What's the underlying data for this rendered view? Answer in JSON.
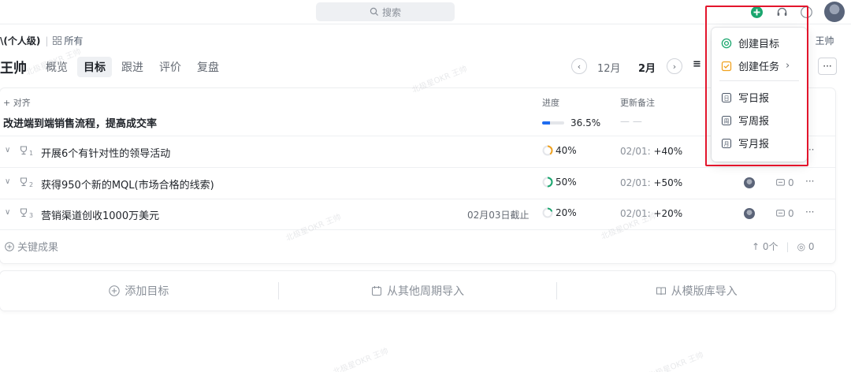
{
  "topbar": {
    "search_placeholder": "搜索"
  },
  "header": {
    "breadcrumb_scope": "\\(个人级)",
    "breadcrumb_all": "所有",
    "breadcrumb_right": "王帅",
    "owner": "王帅",
    "tabs": [
      "概览",
      "目标",
      "跟进",
      "评价",
      "复盘"
    ],
    "active_tab": "目标",
    "months": {
      "prev": "12月",
      "current": "2月"
    },
    "more": "···"
  },
  "table": {
    "align_label": "+ 对齐",
    "col_progress": "进度",
    "col_note": "更新备注",
    "objective": {
      "title": "改进端到端销售流程，提高成交率",
      "progress": 36.5,
      "progress_label": "36.5%",
      "note": "— —"
    },
    "key_results": [
      {
        "index": "1",
        "title": "开展6个有针对性的领导活动",
        "deadline": "",
        "progress": 0.4,
        "progress_label": "40%",
        "note_date": "02/01:",
        "note_value": "+40%",
        "comments": "",
        "more": "···"
      },
      {
        "index": "2",
        "title": "获得950个新的MQL(市场合格的线索)",
        "deadline": "",
        "progress": 0.5,
        "progress_label": "50%",
        "note_date": "02/01:",
        "note_value": "+50%",
        "comments": "0",
        "more": "···"
      },
      {
        "index": "3",
        "title": "营销渠道创收1000万美元",
        "deadline": "02月03日截止",
        "progress": 0.2,
        "progress_label": "20%",
        "note_date": "02/01:",
        "note_value": "+20%",
        "comments": "0",
        "more": "···"
      }
    ],
    "add_kr": "关键成果",
    "stats": {
      "up": "0个",
      "views": "0"
    }
  },
  "actions": {
    "add_goal": "添加目标",
    "import_period": "从其他周期导入",
    "import_template": "从模版库导入"
  },
  "menu": {
    "create_goal": "创建目标",
    "create_task": "创建任务",
    "daily": "写日报",
    "weekly": "写周报",
    "monthly": "写月报",
    "daily_glyph": "日",
    "weekly_glyph": "周",
    "monthly_glyph": "月"
  },
  "colors": {
    "accent_blue": "#1f6cf0",
    "create_green": "#1aa66e",
    "progress_orange": "#f0a21f",
    "highlight_red": "#e3152c"
  }
}
